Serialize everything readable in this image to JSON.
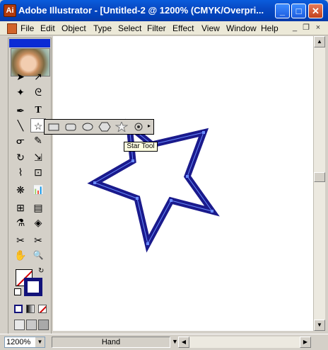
{
  "window": {
    "title": "Adobe Illustrator - [Untitled-2 @ 1200% (CMYK/Overpri...",
    "app_icon_glyph": "Ai",
    "minimize": "_",
    "maximize": "□",
    "close": "✕"
  },
  "menu": {
    "items": [
      "File",
      "Edit",
      "Object",
      "Type",
      "Select",
      "Filter",
      "Effect",
      "View",
      "Window",
      "Help"
    ],
    "doc_minimize": "_",
    "doc_restore": "❐",
    "doc_close": "×"
  },
  "tools": {
    "selection": "➤",
    "direct_selection": "↗",
    "magic_wand": "✦",
    "lasso": "ᘓ",
    "pen": "✒",
    "type": "T",
    "line": "╲",
    "star": "☆",
    "paintbrush": "ᓂ",
    "pencil": "✎",
    "rotate": "↻",
    "scale": "⇲",
    "warp": "⌇",
    "free_transform": "⊡",
    "symbol_sprayer": "❋",
    "graph": "📊",
    "mesh": "⊞",
    "gradient": "▤",
    "eyedropper": "⚗",
    "blend": "◈",
    "slice": "✂",
    "scissors": "✂",
    "hand": "✋",
    "zoom": "🔍"
  },
  "flyout": {
    "tooltip": "Star Tool",
    "items": [
      "rectangle",
      "rounded-rectangle",
      "ellipse",
      "polygon",
      "star",
      "flare"
    ]
  },
  "colors": {
    "stroke": "#12127a",
    "star_outline": "#1a1a8c",
    "selection": "#6a8cff"
  },
  "status": {
    "zoom": "1200%",
    "tool": "Hand"
  }
}
